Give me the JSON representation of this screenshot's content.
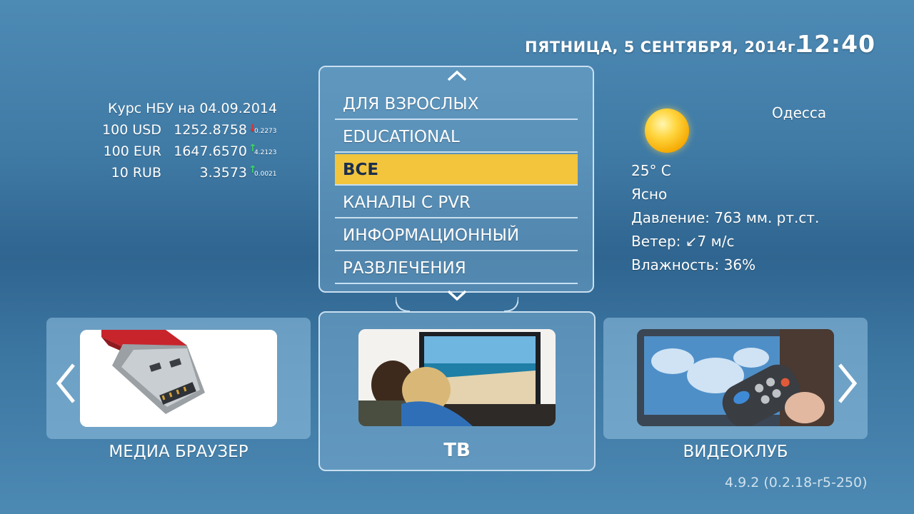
{
  "header": {
    "date": "ПЯТНИЦА, 5 СЕНТЯБРЯ, 2014г.",
    "time": "12:40"
  },
  "rates": {
    "title": "Курс НБУ на 04.09.2014",
    "rows": [
      {
        "name": "100 USD",
        "value": "1252.8758",
        "direction": "down",
        "delta": "0.2273"
      },
      {
        "name": "100 EUR",
        "value": "1647.6570",
        "direction": "up",
        "delta": "4.2123"
      },
      {
        "name": "10 RUB",
        "value": "3.3573",
        "direction": "up",
        "delta": "0.0021"
      }
    ]
  },
  "weather": {
    "city": "Одесса",
    "icon": "sun-icon",
    "temperature": "25° C",
    "condition": "Ясно",
    "pressure": "Давление: 763 мм. рт.ст.",
    "wind_label": "Ветер:",
    "wind_arrow": "↙",
    "wind_value": "7 м/с",
    "humidity": "Влажность: 36%"
  },
  "categories": {
    "items": [
      "ДЛЯ ВЗРОСЛЫХ",
      "EDUCATIONAL",
      "ВСЕ",
      "КАНАЛЫ С PVR",
      "ИНФОРМАЦИОННЫЙ",
      "РАЗВЛЕЧЕНИЯ"
    ],
    "selected": "ВСЕ"
  },
  "tiles": {
    "left": {
      "label": "МЕДИА БРАУЗЕР",
      "image": "usb-flash-drive"
    },
    "center": {
      "label": "ТВ",
      "image": "couple-watching-tv"
    },
    "right": {
      "label": "ВИДЕОКЛУБ",
      "image": "remote-control"
    }
  },
  "colors": {
    "accent": "#f2c53d",
    "border": "#c8dff0",
    "down": "#e03232",
    "up": "#3fd46a"
  },
  "version": "4.9.2 (0.2.18-r5-250)"
}
